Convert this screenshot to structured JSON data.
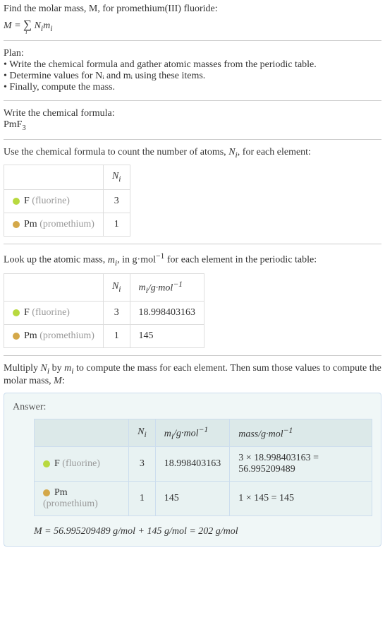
{
  "title": "Find the molar mass, M, for promethium(III) fluoride:",
  "formula_lhs": "M = ",
  "formula_sigma_sub": "i",
  "formula_rhs": " NᵢMᵢ",
  "plan_label": "Plan:",
  "plan_items": [
    "Write the chemical formula and gather atomic masses from the periodic table.",
    "Determine values for Nᵢ and mᵢ using these items.",
    "Finally, compute the mass."
  ],
  "write_formula_label": "Write the chemical formula:",
  "chemical_formula_base": "PmF",
  "chemical_formula_sub": "3",
  "count_atoms_text": "Use the chemical formula to count the number of atoms, Nᵢ, for each element:",
  "table1": {
    "header_ni": "Nᵢ",
    "rows": [
      {
        "symbol": "F",
        "name": "(fluorine)",
        "ni": "3"
      },
      {
        "symbol": "Pm",
        "name": "(promethium)",
        "ni": "1"
      }
    ]
  },
  "lookup_text_pre": "Look up the atomic mass, mᵢ, in g·mol",
  "lookup_text_sup": "−1",
  "lookup_text_post": " for each element in the periodic table:",
  "table2": {
    "header_ni": "Nᵢ",
    "header_mi_pre": "mᵢ/g·mol",
    "header_mi_sup": "−1",
    "rows": [
      {
        "symbol": "F",
        "name": "(fluorine)",
        "ni": "3",
        "mi": "18.998403163"
      },
      {
        "symbol": "Pm",
        "name": "(promethium)",
        "ni": "1",
        "mi": "145"
      }
    ]
  },
  "multiply_text": "Multiply Nᵢ by mᵢ to compute the mass for each element. Then sum those values to compute the molar mass, M:",
  "answer_label": "Answer:",
  "table3": {
    "header_ni": "Nᵢ",
    "header_mi_pre": "mᵢ/g·mol",
    "header_mi_sup": "−1",
    "header_mass_pre": "mass/g·mol",
    "header_mass_sup": "−1",
    "rows": [
      {
        "symbol": "F",
        "name": "(fluorine)",
        "ni": "3",
        "mi": "18.998403163",
        "mass": "3 × 18.998403163 = 56.995209489"
      },
      {
        "symbol": "Pm",
        "name": "(promethium)",
        "ni": "1",
        "mi": "145",
        "mass": "1 × 145 = 145"
      }
    ]
  },
  "final_answer": "M = 56.995209489 g/mol + 145 g/mol = 202 g/mol",
  "chart_data": {
    "type": "table",
    "title": "Molar mass computation for promethium(III) fluoride (PmF3)",
    "elements": [
      {
        "element": "F",
        "name": "fluorine",
        "count": 3,
        "atomic_mass_g_per_mol": 18.998403163,
        "mass_contribution_g_per_mol": 56.995209489
      },
      {
        "element": "Pm",
        "name": "promethium",
        "count": 1,
        "atomic_mass_g_per_mol": 145,
        "mass_contribution_g_per_mol": 145
      }
    ],
    "molar_mass_g_per_mol": 202
  }
}
